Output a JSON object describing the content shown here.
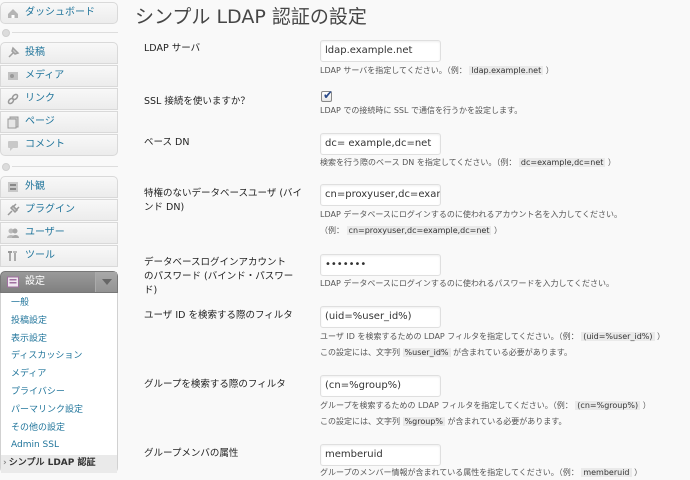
{
  "menu": {
    "dashboard": "ダッシュボード",
    "posts": "投稿",
    "media": "メディア",
    "links": "リンク",
    "pages": "ページ",
    "comments": "コメント",
    "appearance": "外観",
    "plugins": "プラグイン",
    "users": "ユーザー",
    "tools": "ツール",
    "settings": "設定",
    "submenu": [
      "一般",
      "投稿設定",
      "表示設定",
      "ディスカッション",
      "メディア",
      "プライバシー",
      "パーマリンク設定",
      "その他の設定",
      "Admin SSL",
      "シンプル LDAP 認証"
    ]
  },
  "page": {
    "title": "シンプル LDAP 認証の設定"
  },
  "fields": {
    "server": {
      "label": "LDAP サーバ",
      "value": "ldap.example.net",
      "desc_pre": "LDAP サーバを指定してください。（例：",
      "example": "ldap.example.net",
      "desc_post": "）"
    },
    "ssl": {
      "label": "SSL 接続を使いますか？",
      "checked": true,
      "desc": "LDAP での接続時に SSL で通信を行うかを設定します。"
    },
    "basedn": {
      "label": "ベース DN",
      "value": "dc= example,dc=net",
      "desc_pre": "検索を行う際のベース DN を指定してください。（例：",
      "example": "dc=example,dc=net",
      "desc_post": "）"
    },
    "binddn": {
      "label": "特権のないデータベースユーザ (バインド DN)",
      "value": "cn=proxyuser,dc=example,dc=net",
      "desc": "LDAP データベースにログインするのに使われるアカウント名を入力してください。",
      "desc2_pre": "（例：",
      "example": "cn=proxyuser,dc=example,dc=net",
      "desc2_post": "）"
    },
    "bindpw": {
      "label": "データベースログインアカウントのパスワード (バインド・パスワード)",
      "value": "•••••••",
      "desc": "LDAP データベースにログインするのに使われるパスワードを入力してください。"
    },
    "userfilter": {
      "label": "ユーザ ID を検索する際のフィルタ",
      "value": "(uid=%user_id%)",
      "desc_pre": "ユーザ ID を検索するための LDAP フィルタを指定してください。（例：",
      "example": "(uid=%user_id%)",
      "desc_post": "）",
      "desc2_pre": "この設定には、文字列",
      "example2": "%user_id%",
      "desc2_post": "が含まれている必要があります。"
    },
    "groupfilter": {
      "label": "グループを検索する際のフィルタ",
      "value": "(cn=%group%)",
      "desc_pre": "グループを検索するための LDAP フィルタを指定してください。（例：",
      "example": "(cn=%group%)",
      "desc_post": "）",
      "desc2_pre": "この設定には、文字列",
      "example2": "%group%",
      "desc2_post": "が含まれている必要があります。"
    },
    "member": {
      "label": "グループメンバの属性",
      "value": "memberuid",
      "desc_pre": "グループのメンバー情報が含まれている属性を指定してください。（例：",
      "example": "memberuid",
      "desc_post": "）"
    }
  }
}
